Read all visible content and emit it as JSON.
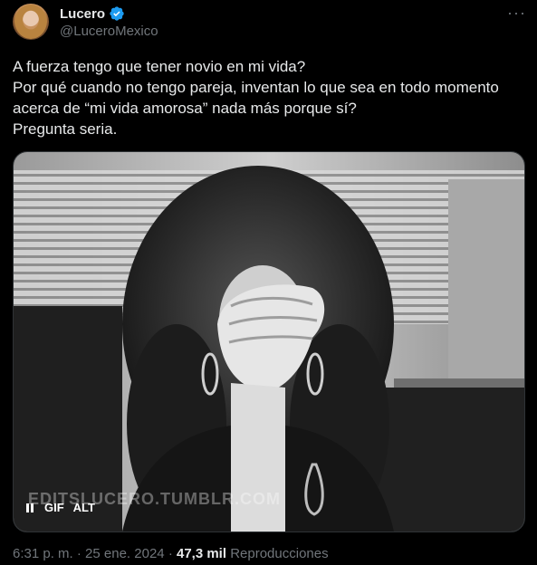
{
  "author": {
    "display_name": "Lucero",
    "handle": "@LuceroMexico",
    "verified": true,
    "verified_color": "#1d9bf0"
  },
  "more_icon": "more-horizontal-icon",
  "tweet": {
    "lines": [
      "A fuerza tengo que tener novio en mi vida?",
      "Por qué cuando no tengo pareja, inventan lo que sea en todo momento",
      "acerca de “mi vida amorosa” nada más porque sí?",
      "Pregunta seria."
    ]
  },
  "media": {
    "watermark": "EDITSLUCERO.TUMBLR.COM",
    "gif_label": "GIF",
    "alt_label": "ALT",
    "pause_icon": "pause-icon"
  },
  "meta": {
    "time": "6:31 p. m.",
    "separator": "·",
    "date": "25 ene. 2024",
    "views_count": "47,3 mil",
    "views_label": "Reproducciones"
  }
}
